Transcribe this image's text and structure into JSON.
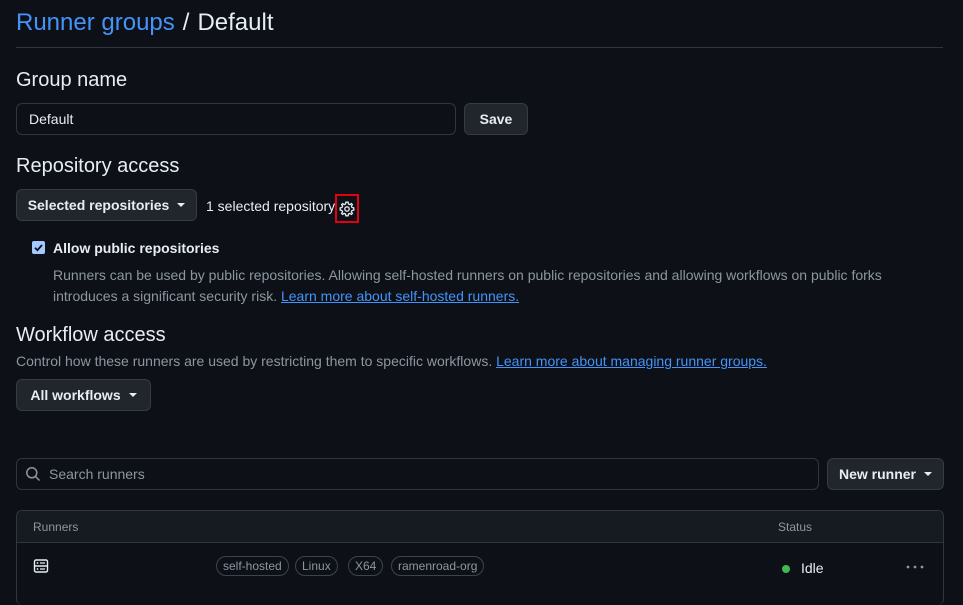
{
  "header": {
    "crumb": "Runner groups",
    "separator": "/",
    "current": "Default"
  },
  "group_name": {
    "title": "Group name",
    "value": "Default",
    "save_label": "Save"
  },
  "repository_access": {
    "title": "Repository access",
    "dropdown_label": "Selected repositories",
    "selected_count_text": "1 selected repository",
    "allow_public_label": "Allow public repositories",
    "allow_public_checked": true,
    "description_line1": "Runners can be used by public repositories. Allowing self-hosted runners on public repositories and allowing workflows on public forks",
    "description_line2": "introduces a significant security risk.",
    "learn_more_link": "Learn more about self-hosted runners."
  },
  "workflow_access": {
    "title": "Workflow access",
    "description": "Control how these runners are used by restricting them to specific workflows.",
    "learn_more_link": "Learn more about managing runner groups.",
    "dropdown_label": "All workflows"
  },
  "search": {
    "placeholder": "Search runners",
    "new_runner_label": "New runner"
  },
  "runners_table": {
    "columns": [
      "Runners",
      "Status"
    ],
    "rows": [
      {
        "labels": [
          "self-hosted",
          "Linux",
          "X64",
          "ramenroad-org"
        ],
        "status": "Idle"
      }
    ]
  },
  "colors": {
    "background": "#0d1117",
    "link": "#4493f8",
    "status_idle": "#3fb950",
    "highlight_box": "#e5000f"
  },
  "icons": [
    "gear-icon",
    "search-icon",
    "server-icon",
    "kebab-menu-icon",
    "checkmark-icon",
    "caret-down-icon"
  ]
}
